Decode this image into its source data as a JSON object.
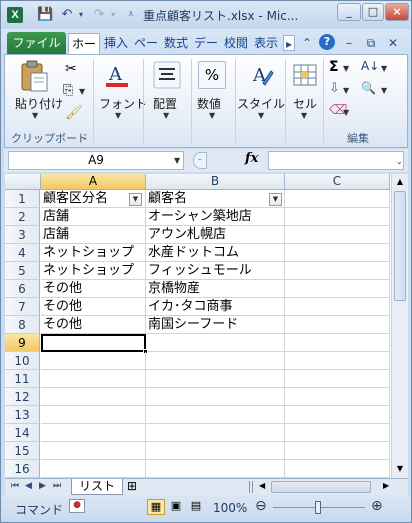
{
  "app": {
    "title": "重点顧客リスト.xlsx - Mic...",
    "window_buttons": [
      "_",
      "□",
      "×"
    ]
  },
  "ribbon": {
    "file_tab": "ファイル",
    "tabs": [
      "ホー",
      "挿入",
      "ペー",
      "数式",
      "デー",
      "校閲",
      "表示"
    ],
    "active_tab_index": 0,
    "groups": {
      "clipboard": {
        "paste": "貼り付け",
        "label": "クリップボード"
      },
      "font": {
        "label": "フォント"
      },
      "alignment": {
        "label": "配置"
      },
      "number": {
        "label": "数値",
        "symbol": "%"
      },
      "styles": {
        "label": "スタイル"
      },
      "cells": {
        "label": "セル"
      },
      "editing": {
        "label": "編集"
      }
    }
  },
  "formula_bar": {
    "name_box": "A9",
    "fx": "fx",
    "value": ""
  },
  "grid": {
    "columns": [
      "A",
      "B",
      "C"
    ],
    "rows": [
      {
        "num": "1",
        "a": "顧客区分名",
        "b": "顧客名"
      },
      {
        "num": "2",
        "a": "店舗",
        "b": "オーシャン築地店"
      },
      {
        "num": "3",
        "a": "店舗",
        "b": "アウン札幌店"
      },
      {
        "num": "4",
        "a": "ネットショップ",
        "b": "水産ドットコム"
      },
      {
        "num": "5",
        "a": "ネットショップ",
        "b": "フィッシュモール"
      },
      {
        "num": "6",
        "a": "その他",
        "b": "京橋物産"
      },
      {
        "num": "7",
        "a": "その他",
        "b": "イカ･タコ商事"
      },
      {
        "num": "8",
        "a": "その他",
        "b": "南国シーフード"
      },
      {
        "num": "9",
        "a": "",
        "b": ""
      },
      {
        "num": "10",
        "a": "",
        "b": ""
      },
      {
        "num": "11",
        "a": "",
        "b": ""
      },
      {
        "num": "12",
        "a": "",
        "b": ""
      },
      {
        "num": "13",
        "a": "",
        "b": ""
      },
      {
        "num": "14",
        "a": "",
        "b": ""
      },
      {
        "num": "15",
        "a": "",
        "b": ""
      },
      {
        "num": "16",
        "a": "",
        "b": ""
      }
    ],
    "selected_cell": "A9"
  },
  "sheet_tabs": [
    "リスト"
  ],
  "status": {
    "mode": "コマンド",
    "zoom": "100%"
  }
}
